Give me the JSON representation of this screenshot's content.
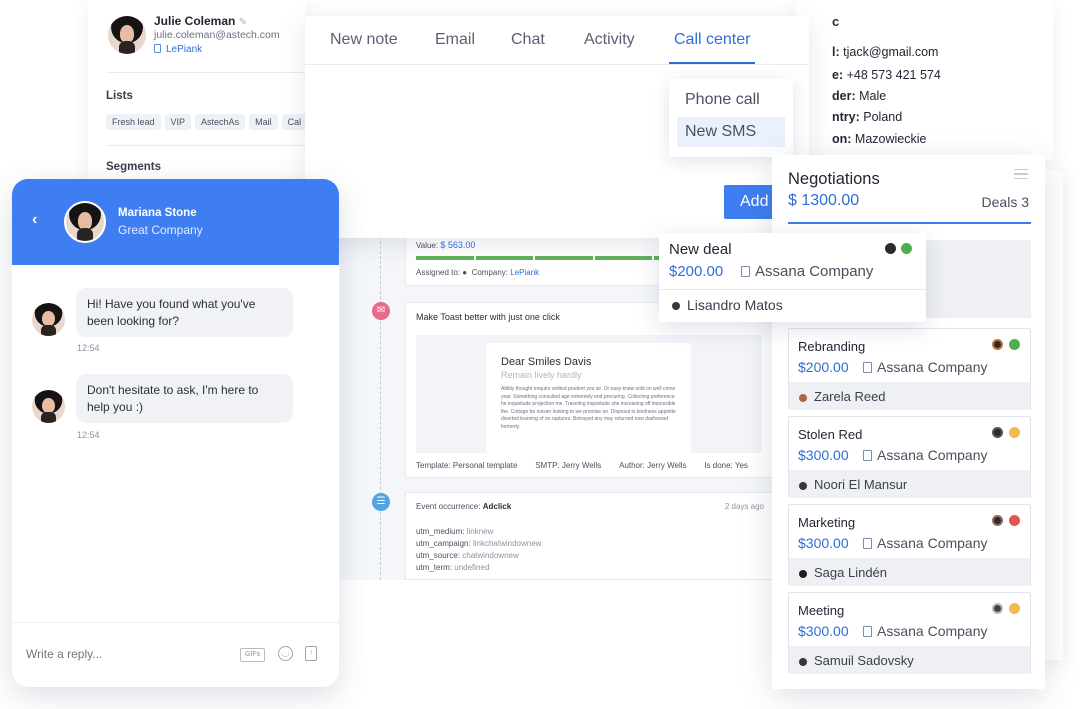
{
  "profile": {
    "name": "Julie Coleman",
    "email": "julie.coleman@astech.com",
    "company": "LePiank",
    "lists_heading": "Lists",
    "lists": [
      "Fresh lead",
      "VIP",
      "AstechAs",
      "Mail",
      "Cal"
    ],
    "segments_heading": "Segments"
  },
  "info": {
    "title": "c",
    "rows": [
      {
        "label": "l:",
        "value": "tjack@gmail.com"
      },
      {
        "label": "e:",
        "value": "+48 573 421 574"
      },
      {
        "label": "der:",
        "value": "Male"
      },
      {
        "label": "ntry:",
        "value": "Poland"
      },
      {
        "label": "on:",
        "value": "Mazowieckie"
      }
    ]
  },
  "tabs": {
    "items": [
      "New note",
      "Email",
      "Chat",
      "Activity",
      "Call center"
    ],
    "active": "Call center",
    "add_label": "Add",
    "dropdown": [
      "Phone call",
      "New SMS"
    ]
  },
  "timeline": {
    "deal_value_label": "Value:",
    "deal_value": "$ 563.00",
    "assigned_label": "Assigned to:",
    "company_label": "Company:",
    "company": "LePiank",
    "email_subject": "Make Toast better with just one click",
    "letter_greeting": "Dear Smiles Davis",
    "letter_subtitle": "Remain lively hardly",
    "letter_body": "Ability thought enquire settled prudent you sir. Or easy knew sold on well come year. Something consulted age extremely end procuring. Collecting preference he inquietude projection me. Traveling inquietude she increasing off impossible the. Cottage be noisier looking to we promise on. Disposal to kindness appetite diverted learning of on raptures. Betrayed any may returned now dashwood formerly.",
    "template_label": "Template:",
    "template": "Personal template",
    "smtp_label": "SMTP:",
    "smtp": "Jerry Wells",
    "author_label": "Author:",
    "author": "Jerry Wells",
    "done_label": "Is done:",
    "done": "Yes",
    "event_label": "Event occurrence:",
    "event": "Adclick",
    "event_time": "2 days ago",
    "utm": [
      {
        "key": "utm_medium:",
        "value": "linknew"
      },
      {
        "key": "utm_campaign:",
        "value": "linkchatwindownew"
      },
      {
        "key": "utm_source:",
        "value": "chatwindownew"
      },
      {
        "key": "utm_term:",
        "value": "undefined"
      }
    ]
  },
  "chat": {
    "name": "Mariana Stone",
    "company": "Great Company",
    "messages": [
      {
        "text": "Hi! Have you found what you've been looking for?",
        "time": "12:54"
      },
      {
        "text": "Don't hesitate to ask, I'm here to help you :)",
        "time": "12:54"
      }
    ],
    "placeholder": "Write a reply...",
    "gif_label": "GIFs",
    "accent": "#3e7ef0"
  },
  "negotiations": {
    "title": "Negotiations",
    "total": "$ 1300.00",
    "deals_label": "Deals 3",
    "deals": [
      {
        "title": "Rebranding",
        "value": "$200.00",
        "company": "Assana Company",
        "person": "Zarela Reed",
        "status": "#4cb050"
      },
      {
        "title": "Stolen Red",
        "value": "$300.00",
        "company": "Assana Company",
        "person": "Noori El Mansur",
        "status": "#f2b94b"
      },
      {
        "title": "Marketing",
        "value": "$300.00",
        "company": "Assana Company",
        "person": "Saga Lindén",
        "status": "#e55353"
      },
      {
        "title": "Meeting",
        "value": "$300.00",
        "company": "Assana Company",
        "person": "Samuil Sadovsky",
        "status": "#f2b94b"
      }
    ]
  },
  "new_deal": {
    "title": "New deal",
    "value": "$200.00",
    "company": "Assana Company",
    "person": "Lisandro Matos",
    "status": "#4cb050"
  }
}
